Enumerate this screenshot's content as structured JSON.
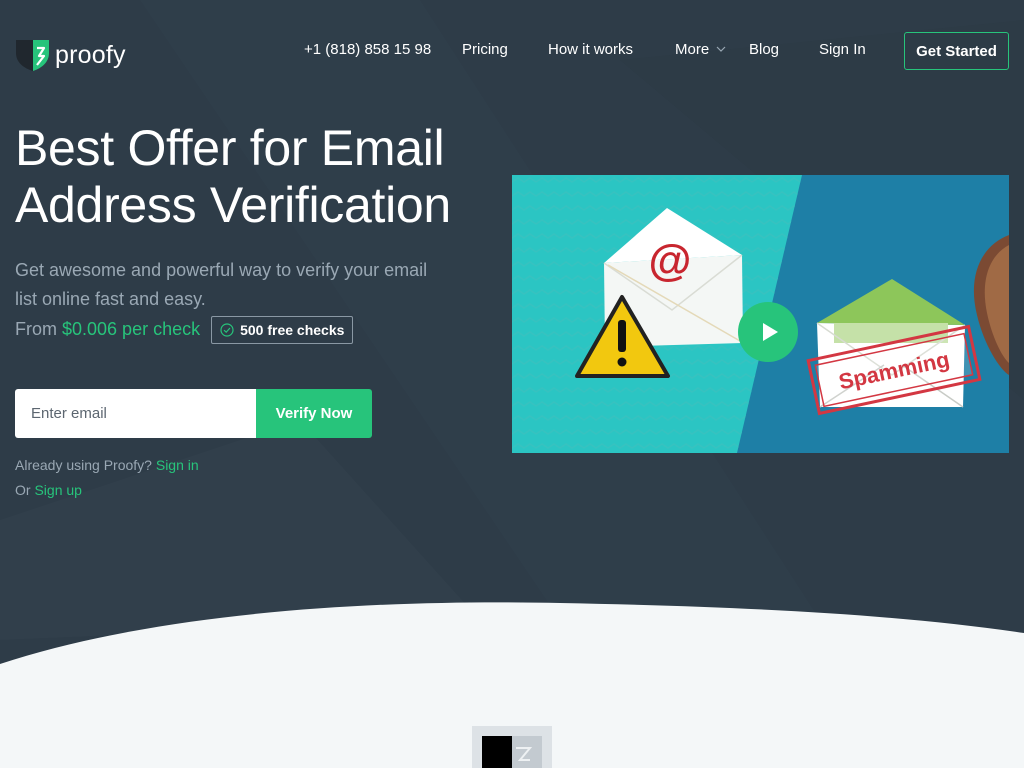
{
  "brand": {
    "name": "proofy",
    "accent": "#27c47b",
    "background": "#2e3c48"
  },
  "nav": {
    "phone": "+1 (818) 858 15 98",
    "pricing": "Pricing",
    "how_it_works": "How it works",
    "more": "More",
    "blog": "Blog",
    "sign_in": "Sign In",
    "get_started": "Get Started"
  },
  "hero": {
    "headline": "Best Offer for Email Address Verification",
    "subtitle": "Get awesome and powerful way to verify your email list online fast and easy.",
    "price_prefix": "From",
    "price": "$0.006 per check",
    "badge": "500 free checks",
    "badge_icon": "check-circle-icon"
  },
  "form": {
    "email_placeholder": "Enter email",
    "email_value": "",
    "verify_label": "Verify Now"
  },
  "links": {
    "already_text": "Already using Proofy?",
    "sign_in": "Sign in",
    "or_text": "Or",
    "sign_up": "Sign up"
  },
  "video": {
    "envelope_symbol": "@",
    "stamp_text": "Spamming",
    "play_icon": "play-icon",
    "warning_icon": "warning-icon"
  }
}
